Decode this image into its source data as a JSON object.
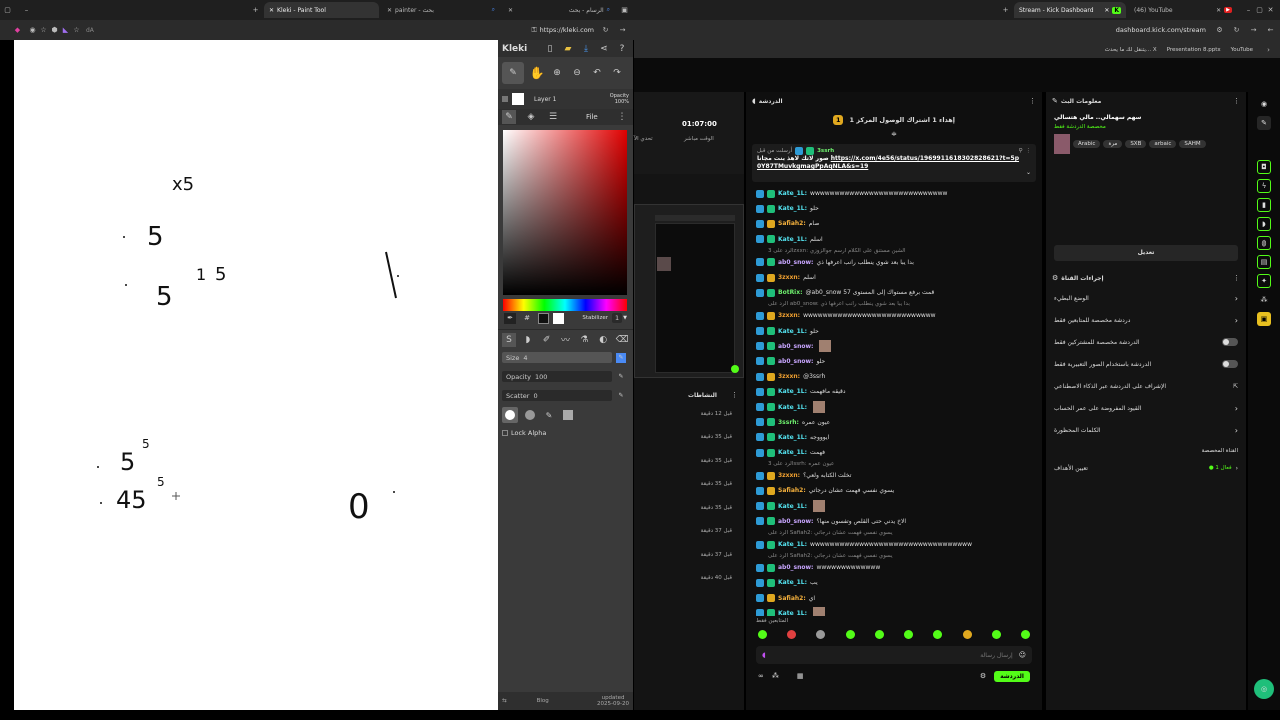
{
  "left_window": {
    "tabs": [
      {
        "label": "Kleki - Paint Tool"
      },
      {
        "label": "painter - بحث"
      },
      {
        "label": "الرسام - بحث"
      }
    ],
    "address": "https://kleki.com",
    "ext_text": "dA",
    "kleki": {
      "logo": "Kleki",
      "layer": "Layer 1",
      "opacity_label": "Opacity",
      "opacity_value": "100%",
      "file_label": "File",
      "stabilizer_label": "Stabilizer",
      "stabilizer_value": "1",
      "size_label": "Size",
      "size_value": "4",
      "opacity_brush_label": "Opacity",
      "opacity_brush_value": "100",
      "scatter_label": "Scatter",
      "scatter_value": "0",
      "lock_alpha": "Lock Alpha",
      "blog": "Blog",
      "updated": "updated",
      "updated_date": "2025-09-20"
    },
    "canvas_strokes": [
      {
        "text": "x5"
      },
      {
        "text": "5"
      },
      {
        "text": "5"
      },
      {
        "text": "1"
      },
      {
        "text": "5"
      },
      {
        "text": "5"
      },
      {
        "text": "5"
      },
      {
        "text": "45"
      },
      {
        "text": "5"
      },
      {
        "text": "0"
      }
    ]
  },
  "right_window": {
    "tabs": [
      {
        "label": "Stream - Kick Dashboard"
      },
      {
        "label": "(46) YouTube"
      }
    ],
    "address": "dashboard.kick.com/stream",
    "bookmarks": [
      {
        "label": "يتنقل لك ما يحدث... X"
      },
      {
        "label": "Presentation 8.pptx"
      },
      {
        "label": "YouTube"
      }
    ],
    "stats": {
      "time_value": "01:07:00",
      "time_label": "الوقت مباشر",
      "other_label": "تحدي الآ"
    },
    "activity": {
      "title": "النشاطات",
      "times": [
        "قبل 12 دقيقة",
        "قبل 35 دقيقة",
        "قبل 35 دقيقة",
        "قبل 35 دقيقة",
        "قبل 35 دقيقة",
        "قبل 37 دقيقة",
        "قبل 37 دقيقة",
        "قبل 40 دقيقة"
      ]
    },
    "chat": {
      "title": "الدردشة",
      "gift_text": "إهداء 1 اشتراك الوصول المركز 1",
      "gift_count": "1",
      "pinned_by_label": "أرسلت من قبل",
      "pinned_user": "3ssrh",
      "pinned_text": "صور لاتك لاهذ بنت مجانا",
      "pinned_link": "https://x.com/4e56/status/1969911618302828621?t=5p0Y87TMuvkgmagPpAqNLA&s=19",
      "lines": [
        {
          "user": "Kate_1L:",
          "text": "wwwwwwwwwwwwwwwwwwwwwwwwwwww",
          "cls": "uk",
          "reply": ""
        },
        {
          "user": "Kate_1L:",
          "text": "حلو",
          "cls": "uk",
          "reply": ""
        },
        {
          "user": "Safiah2:",
          "text": "صام",
          "cls": "us",
          "reply": ""
        },
        {
          "user": "Kate_1L:",
          "text": "اسلم",
          "cls": "uk",
          "reply": ""
        },
        {
          "user": "ab0_snow:",
          "text": "بدا يبا بعد شوي ينطلب رانب اعرفها ذي",
          "cls": "ua",
          "reply": "الرد على 3zxxn: الشين مستنق على الكلام ارسم جوالزوزي"
        },
        {
          "user": "3zxxn:",
          "text": "اسلم",
          "cls": "u3",
          "reply": ""
        },
        {
          "user": "BotRix:",
          "text": "@ab0_snow 57 قمت برفع مستواك إلى المستوى",
          "cls": "ub",
          "reply": ""
        },
        {
          "user": "3zxxn:",
          "text": "wwwwwwwwwwwwwwwwwwwwwwwwwww",
          "cls": "u3",
          "reply": "الرد على ab0_snow: بدا يبا بعد شوي ينطلب رانب اعرفها ذي"
        },
        {
          "user": "Kate_1L:",
          "text": "حلو",
          "cls": "uk",
          "reply": ""
        },
        {
          "user": "ab0_snow:",
          "text": "",
          "cls": "ua",
          "reply": ""
        },
        {
          "user": "ab0_snow:",
          "text": "حلو",
          "cls": "ua",
          "reply": ""
        },
        {
          "user": "3zxxn:",
          "text": "@3ssrh",
          "cls": "u3",
          "reply": ""
        },
        {
          "user": "Kate_1L:",
          "text": "دقيقه مافهمت",
          "cls": "uk",
          "reply": ""
        },
        {
          "user": "Kate_1L:",
          "text": "",
          "cls": "uk",
          "reply": ""
        },
        {
          "user": "3ssrh:",
          "text": "عيون عمره",
          "cls": "ub",
          "reply": ""
        },
        {
          "user": "Kate_1L:",
          "text": "ايوووجه",
          "cls": "uk",
          "reply": ""
        },
        {
          "user": "Kate_1L:",
          "text": "فهمت",
          "cls": "uk",
          "reply": ""
        },
        {
          "user": "3zxxn:",
          "text": "تخلت الكتابه ولعي؟",
          "cls": "u3",
          "reply": "الرد على 3ssrh: عيون عمره"
        },
        {
          "user": "Safiah2:",
          "text": "يسوي نفسي فهمت عشان درجاتي",
          "cls": "us",
          "reply": ""
        },
        {
          "user": "Kate_1L:",
          "text": "",
          "cls": "uk",
          "reply": ""
        },
        {
          "user": "ab0_snow:",
          "text": "الاخ يدني حتى القلص وتفسون منها؟",
          "cls": "ua",
          "reply": ""
        },
        {
          "user": "Kate_1L:",
          "text": "wwwwwwwwwwwwwwwwwwwwwwwwwwwwwwwww",
          "cls": "uk",
          "reply": "الرد على Safiah2: يسوي نفسي فهمت عشان درجاتي"
        },
        {
          "user": "ab0_snow:",
          "text": "wwwwwwwwwwwww",
          "cls": "ua",
          "reply": "الرد على Safiah2: يسوي نفسي فهمت عشان درجاتي"
        },
        {
          "user": "Kate_1L:",
          "text": "يب",
          "cls": "uk",
          "reply": ""
        },
        {
          "user": "Safiah2:",
          "text": "اي",
          "cls": "us",
          "reply": ""
        },
        {
          "user": "Kate_1L:",
          "text": "",
          "cls": "uk",
          "reply": ""
        }
      ],
      "followers_only": "المتابعين فقط",
      "input_placeholder": "إرسال رسالة",
      "send_label": "الدردشة"
    },
    "stream_info": {
      "title": "معلومات البث",
      "stream_title": "سهم سهمالي.. مالي هتسالي",
      "category": "مخصصة الدردشة فقط",
      "tags": [
        "Arabic",
        "مرة",
        "SXB",
        "arbaic",
        "SAHM"
      ],
      "edit_label": "تعديل"
    },
    "channel_actions": {
      "title": "إجراءات القناة",
      "items": [
        {
          "label": "الوضع البطيء",
          "control": "chevron"
        },
        {
          "label": "دردشة مخصصة للمتابعين فقط",
          "control": "chevron"
        },
        {
          "label": "الدردشة مخصصة للمشتركين فقط",
          "control": "toggle"
        },
        {
          "label": "الدردشة باستخدام الصور التعبيرية فقط",
          "control": "toggle"
        },
        {
          "label": "الإشراف على الدردشة عبر الذكاء الاصطناعي",
          "control": "ext"
        },
        {
          "label": "القيود المفروضة على عمر الحساب",
          "control": "chevron"
        },
        {
          "label": "الكلمات المحظورة",
          "control": "chevron"
        }
      ],
      "shortcut_label": "القناة المخصصة",
      "goals_label": "تعيين الأهداف",
      "goals_status": "● فعال 1"
    }
  }
}
